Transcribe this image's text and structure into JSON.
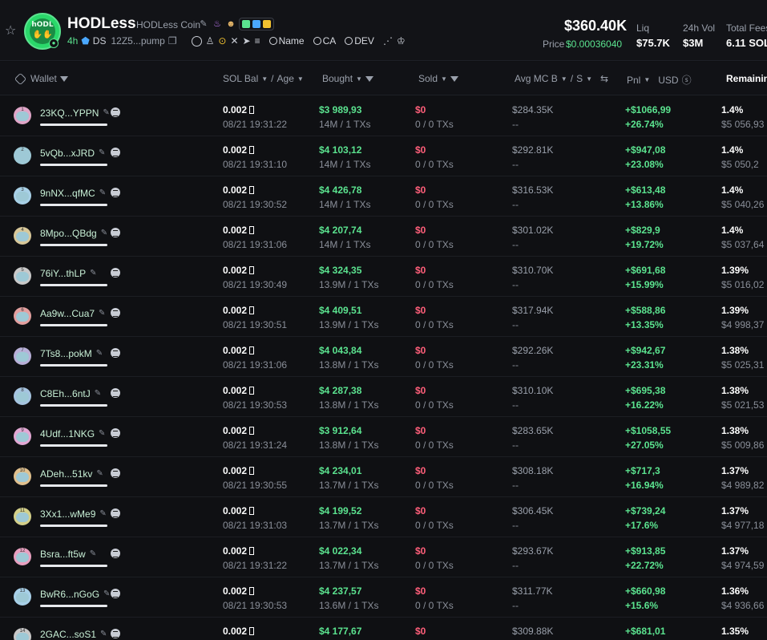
{
  "header": {
    "token_name": "HODLess",
    "token_full_name": "HODLess Coin",
    "logo_text": "hODL",
    "age": "4h",
    "ds_label": "DS",
    "ca_short": "12Z5...pump",
    "search_name": "Name",
    "search_ca": "CA",
    "search_dev": "DEV",
    "market_cap": "$360.40K",
    "price_label": "Price",
    "price": "$0.00036040",
    "stats": [
      {
        "label": "Liq",
        "value": "$75.7K"
      },
      {
        "label": "24h Vol",
        "value": "$3M"
      },
      {
        "label": "Total Fees",
        "value": "6.11 SOL"
      }
    ],
    "colors": {
      "accent": "#5be38f",
      "negative": "#ff5f7a"
    }
  },
  "table": {
    "headers": {
      "wallet": "Wallet",
      "sol_bal": "SOL Bal",
      "age": "Age",
      "bought": "Bought",
      "sold": "Sold",
      "avg_mc": "Avg MC B",
      "avg_s": "S",
      "pnl": "Pnl",
      "currency": "USD",
      "remaining": "Remaining"
    },
    "rows": [
      {
        "rank": "1",
        "wallet": "23KQ...YPPN",
        "sol": "0.002",
        "age": "08/21 19:31:22",
        "bought": "$3 989,93",
        "btx": "14M / 1 TXs",
        "sold": "$0",
        "stx": "0 / 0 TXs",
        "avg": "$284.35K",
        "avs": "--",
        "pnl": "+$1066,99",
        "pct": "+26.74%",
        "rem": "1.4%",
        "remv": "$5 056,93",
        "avatar": "#e0a6c8"
      },
      {
        "rank": "2",
        "wallet": "5vQb...xJRD",
        "sol": "0.002",
        "age": "08/21 19:31:10",
        "bought": "$4 103,12",
        "btx": "14M / 1 TXs",
        "sold": "$0",
        "stx": "0 / 0 TXs",
        "avg": "$292.81K",
        "avs": "--",
        "pnl": "+$947,08",
        "pct": "+23.08%",
        "rem": "1.4%",
        "remv": "$5 050,2",
        "avatar": "#9ec9d6"
      },
      {
        "rank": "3",
        "wallet": "9nNX...qfMC",
        "sol": "0.002",
        "age": "08/21 19:30:52",
        "bought": "$4 426,78",
        "btx": "14M / 1 TXs",
        "sold": "$0",
        "stx": "0 / 0 TXs",
        "avg": "$316.53K",
        "avs": "--",
        "pnl": "+$613,48",
        "pct": "+13.86%",
        "rem": "1.4%",
        "remv": "$5 040,26",
        "avatar": "#a8d0e6"
      },
      {
        "rank": "4",
        "wallet": "8Mpo...QBdg",
        "sol": "0.002",
        "age": "08/21 19:31:06",
        "bought": "$4 207,74",
        "btx": "14M / 1 TXs",
        "sold": "$0",
        "stx": "0 / 0 TXs",
        "avg": "$301.02K",
        "avs": "--",
        "pnl": "+$829,9",
        "pct": "+19.72%",
        "rem": "1.4%",
        "remv": "$5 037,64",
        "avatar": "#d8c89a"
      },
      {
        "rank": "5",
        "wallet": "76iY...thLP",
        "sol": "0.002",
        "age": "08/21 19:30:49",
        "bought": "$4 324,35",
        "btx": "13.9M / 1 TXs",
        "sold": "$0",
        "stx": "0 / 0 TXs",
        "avg": "$310.70K",
        "avs": "--",
        "pnl": "+$691,68",
        "pct": "+15.99%",
        "rem": "1.39%",
        "remv": "$5 016,02",
        "avatar": "#c9c9c9"
      },
      {
        "rank": "6",
        "wallet": "Aa9w...Cua7",
        "sol": "0.002",
        "age": "08/21 19:30:51",
        "bought": "$4 409,51",
        "btx": "13.9M / 1 TXs",
        "sold": "$0",
        "stx": "0 / 0 TXs",
        "avg": "$317.94K",
        "avs": "--",
        "pnl": "+$588,86",
        "pct": "+13.35%",
        "rem": "1.39%",
        "remv": "$4 998,37",
        "avatar": "#e3a0a0"
      },
      {
        "rank": "7",
        "wallet": "7Ts8...pokM",
        "sol": "0.002",
        "age": "08/21 19:31:06",
        "bought": "$4 043,84",
        "btx": "13.8M / 1 TXs",
        "sold": "$0",
        "stx": "0 / 0 TXs",
        "avg": "$292.26K",
        "avs": "--",
        "pnl": "+$942,67",
        "pct": "+23.31%",
        "rem": "1.38%",
        "remv": "$5 025,31",
        "avatar": "#b8b0d8"
      },
      {
        "rank": "8",
        "wallet": "C8Eh...6ntJ",
        "sol": "0.002",
        "age": "08/21 19:30:53",
        "bought": "$4 287,38",
        "btx": "13.8M / 1 TXs",
        "sold": "$0",
        "stx": "0 / 0 TXs",
        "avg": "$310.10K",
        "avs": "--",
        "pnl": "+$695,38",
        "pct": "+16.22%",
        "rem": "1.38%",
        "remv": "$5 021,53",
        "avatar": "#a6c4e0"
      },
      {
        "rank": "9",
        "wallet": "4Udf...1NKG",
        "sol": "0.002",
        "age": "08/21 19:31:24",
        "bought": "$3 912,64",
        "btx": "13.8M / 1 TXs",
        "sold": "$0",
        "stx": "0 / 0 TXs",
        "avg": "$283.65K",
        "avs": "--",
        "pnl": "+$1058,55",
        "pct": "+27.05%",
        "rem": "1.38%",
        "remv": "$5 009,86",
        "avatar": "#e2a8d4"
      },
      {
        "rank": "10",
        "wallet": "ADeh...51kv",
        "sol": "0.002",
        "age": "08/21 19:30:55",
        "bought": "$4 234,01",
        "btx": "13.7M / 1 TXs",
        "sold": "$0",
        "stx": "0 / 0 TXs",
        "avg": "$308.18K",
        "avs": "--",
        "pnl": "+$717,3",
        "pct": "+16.94%",
        "rem": "1.37%",
        "remv": "$4 989,82",
        "avatar": "#e0c08e"
      },
      {
        "rank": "11",
        "wallet": "3Xx1...wMe9",
        "sol": "0.002",
        "age": "08/21 19:31:03",
        "bought": "$4 199,52",
        "btx": "13.7M / 1 TXs",
        "sold": "$0",
        "stx": "0 / 0 TXs",
        "avg": "$306.45K",
        "avs": "--",
        "pnl": "+$739,24",
        "pct": "+17.6%",
        "rem": "1.37%",
        "remv": "$4 977,18",
        "avatar": "#d4d08a"
      },
      {
        "rank": "12",
        "wallet": "Bsra...ft5w",
        "sol": "0.002",
        "age": "08/21 19:31:22",
        "bought": "$4 022,34",
        "btx": "13.7M / 1 TXs",
        "sold": "$0",
        "stx": "0 / 0 TXs",
        "avg": "$293.67K",
        "avs": "--",
        "pnl": "+$913,85",
        "pct": "+22.72%",
        "rem": "1.37%",
        "remv": "$4 974,59",
        "avatar": "#e8a0c0"
      },
      {
        "rank": "13",
        "wallet": "BwR6...nGoG",
        "sol": "0.002",
        "age": "08/21 19:30:53",
        "bought": "$4 237,57",
        "btx": "13.6M / 1 TXs",
        "sold": "$0",
        "stx": "0 / 0 TXs",
        "avg": "$311.77K",
        "avs": "--",
        "pnl": "+$660,98",
        "pct": "+15.6%",
        "rem": "1.36%",
        "remv": "$4 936,66",
        "avatar": "#a8d0e8"
      },
      {
        "rank": "14",
        "wallet": "2GAC...soS1",
        "sol": "0.002",
        "age": "",
        "bought": "$4 177,67",
        "btx": "",
        "sold": "$0",
        "stx": "",
        "avg": "$309.88K",
        "avs": "",
        "pnl": "+$681,01",
        "pct": "",
        "rem": "1.35%",
        "remv": "",
        "avatar": "#c8c8c8"
      }
    ]
  }
}
